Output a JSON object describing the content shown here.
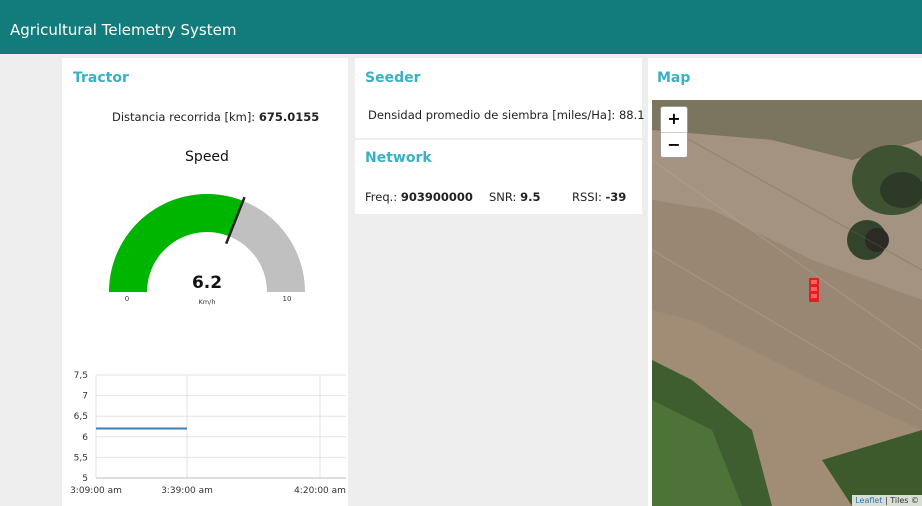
{
  "app": {
    "title": "Agricultural Telemetry System"
  },
  "tractor": {
    "title": "Tractor",
    "distance_label": "Distancia recorrida [km]:",
    "distance_value": "675.0155",
    "gauge": {
      "title": "Speed",
      "value": 6.2,
      "value_text": "6.2",
      "min": 0,
      "max": 10,
      "min_label": "0",
      "max_label": "10",
      "units": "Km/h",
      "fill_color": "#00b500",
      "track_color": "#c0c0c0"
    },
    "chart": {
      "y_ticks": [
        "7,5",
        "7",
        "6,5",
        "6",
        "5,5",
        "5"
      ],
      "x_ticks": [
        "3:09:00 am",
        "3:39:00 am",
        "4:20:00 am"
      ]
    }
  },
  "seeder": {
    "title": "Seeder",
    "density_label": "Densidad promedio de siembra [miles/Ha]:",
    "density_value": "88.1"
  },
  "network": {
    "title": "Network",
    "freq_label": "Freq.:",
    "freq_value": "903900000",
    "snr_label": "SNR:",
    "snr_value": "9.5",
    "rssi_label": "RSSI:",
    "rssi_value": "-39"
  },
  "map": {
    "title": "Map",
    "zoom_in": "+",
    "zoom_out": "−",
    "attribution_link": "Leaflet",
    "attribution_text": "| Tiles ©"
  },
  "chart_data": {
    "type": "line",
    "x": [
      "3:09:00 am",
      "3:39:00 am"
    ],
    "series": [
      {
        "values": [
          6.2,
          6.2
        ]
      }
    ],
    "ylim": [
      5,
      7.5
    ],
    "x_ticks": [
      "3:09:00 am",
      "3:39:00 am",
      "4:20:00 am"
    ],
    "grid": true
  }
}
